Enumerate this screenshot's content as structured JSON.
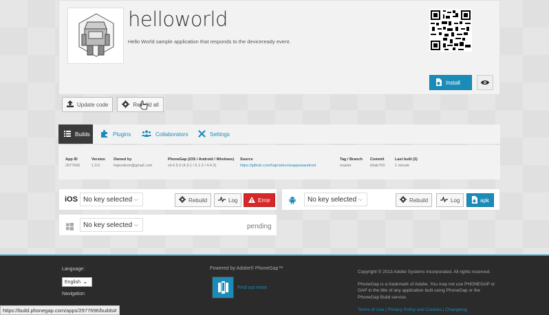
{
  "app": {
    "title": "helloworld",
    "description": "Hello World sample application that responds to the deviceready event.",
    "install_label": "Install"
  },
  "actions": {
    "update_code": "Update code",
    "rebuild_all": "Rebuild all"
  },
  "tabs": [
    {
      "label": "Builds",
      "icon": "list-icon"
    },
    {
      "label": "Plugins",
      "icon": "puzzle-icon"
    },
    {
      "label": "Collaborators",
      "icon": "people-icon"
    },
    {
      "label": "Settings",
      "icon": "tools-icon"
    }
  ],
  "info": {
    "app_id": {
      "h": "App ID",
      "v": "2977696"
    },
    "version": {
      "h": "Version",
      "v": "1.0.0"
    },
    "owned_by": {
      "h": "Owned by",
      "v": "hajirodeon@gmail.com"
    },
    "phonegap": {
      "h": "PhoneGap (iOS / Android / Windows)",
      "v": "cli-6.5.0 (4.3.1 / 6.1.2 / 4.4.3)"
    },
    "source": {
      "h": "Source",
      "v": "https://github.com/hajirodeon/wappswandroid"
    },
    "branch": {
      "h": "Tag / Branch",
      "v": "master"
    },
    "commit": {
      "h": "Commit",
      "v": "b9ab700"
    },
    "last_built": {
      "h": "Last built (3)",
      "v": "1 minute"
    }
  },
  "ios": {
    "label": "iOS",
    "key": "No key selected",
    "rebuild": "Rebuild",
    "log": "Log",
    "status": "Error"
  },
  "android": {
    "key": "No key selected",
    "rebuild": "Rebuild",
    "log": "Log",
    "status": "apk"
  },
  "windows": {
    "key": "No key selected",
    "status": "pending"
  },
  "footer": {
    "language_label": "Language:",
    "language_value": "English",
    "navigation_label": "Navigation",
    "powered_by": "Powered by Adobe® PhoneGap™",
    "find_out_more": "Find out more",
    "copyright": "Copyright © 2013 Adobe Systems Incorporated. All rights reserved.",
    "trademark": "PhoneGap is a trademark of Adobe. You may not use PHONEGAP or GAP in the title of any application built using PhoneGap or the PhoneGap Build service.",
    "links": "Terms of Use | Privacy Policy and Cookies | Changelog"
  },
  "status_bar": "https://build.phonegap.com/apps/2977696/builds#",
  "colors": {
    "accent": "#1b8cb8",
    "error": "#d62828",
    "dark_tab": "#3a3a3a",
    "footer_bg": "#2b2b2b"
  }
}
